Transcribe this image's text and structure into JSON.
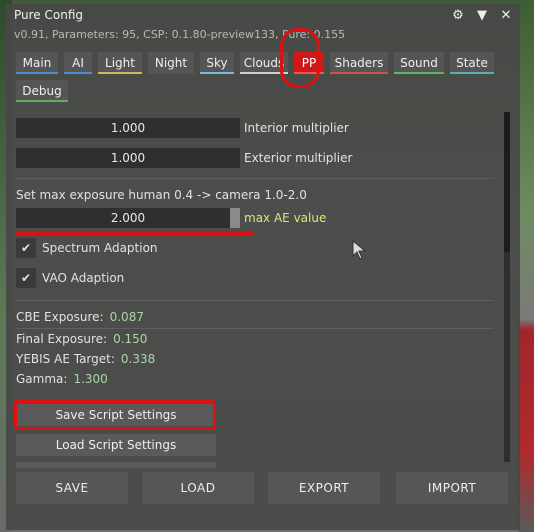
{
  "window": {
    "title": "Pure Config",
    "subtitle": "v0.91, Parameters: 95, CSP: 0.1.80-preview133, Pure: 0.155"
  },
  "icons": {
    "settings": "gear-icon",
    "collapse": "triangle-down-icon",
    "close": "close-icon"
  },
  "tabs": [
    {
      "label": "Main",
      "underline": "#4a8fd4"
    },
    {
      "label": "AI",
      "underline": "#4a8fd4"
    },
    {
      "label": "Light",
      "underline": "#d8b060"
    },
    {
      "label": "Night",
      "underline": "#555555"
    },
    {
      "label": "Sky",
      "underline": "#7fb8e0"
    },
    {
      "label": "Clouds",
      "underline": "#d0d0d0"
    },
    {
      "label": "PP",
      "underline": "#ff5050",
      "active": true
    },
    {
      "label": "Shaders",
      "underline": "#d05050"
    },
    {
      "label": "Sound",
      "underline": "#5cb85c"
    },
    {
      "label": "State",
      "underline": "#5ab0b0"
    },
    {
      "label": "Debug",
      "underline": "#6aa86a"
    }
  ],
  "sliders": {
    "interior": {
      "value": "1.000",
      "label": "Interior multiplier"
    },
    "exterior": {
      "value": "1.000",
      "label": "Exterior multiplier"
    },
    "max_ae": {
      "value": "2.000",
      "label": "max AE value"
    }
  },
  "exposure_note": "Set max exposure human 0.4 -> camera 1.0-2.0",
  "checkboxes": [
    {
      "label": "Spectrum Adaption",
      "checked": true
    },
    {
      "label": "VAO Adaption",
      "checked": true
    }
  ],
  "info": [
    {
      "label": "CBE Exposure:",
      "value": "0.087"
    },
    {
      "label": "Final Exposure:",
      "value": "0.150"
    },
    {
      "label": "YEBIS AE Target:",
      "value": "0.338"
    },
    {
      "label": "Gamma:",
      "value": "1.300"
    }
  ],
  "buttons": {
    "save_script": "Save Script Settings",
    "load_script": "Load Script Settings"
  },
  "footer": {
    "save": "SAVE",
    "load": "LOAD",
    "export": "EXPORT",
    "import": "IMPORT"
  },
  "colors": {
    "accent_green": "#a8d8a8",
    "highlight_red": "#e01010",
    "max_ae_label": "#e6e07a"
  }
}
